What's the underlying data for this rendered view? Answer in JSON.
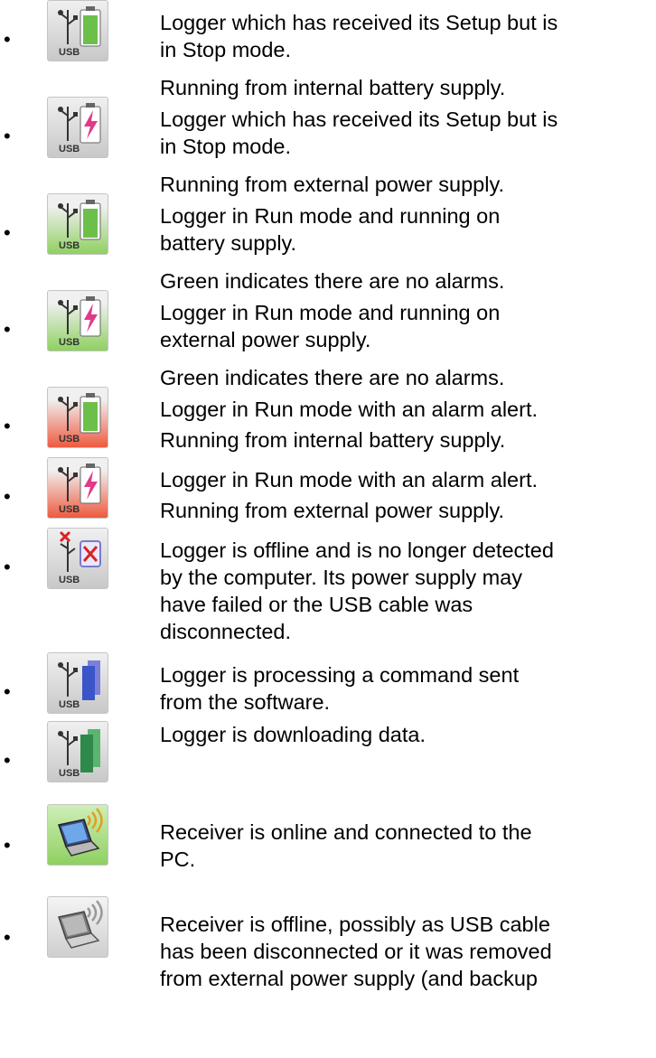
{
  "items": [
    {
      "icon": "usb-logger-battery-stop-icon",
      "bg": "#d8d8d8",
      "text": [
        "Logger which has received its Setup but is",
        "in Stop mode."
      ],
      "sub": "Running from internal battery supply."
    },
    {
      "icon": "usb-logger-external-power-stop-icon",
      "bg": "#d8d8d8",
      "text": [
        "Logger which has received its Setup but is",
        "in Stop mode."
      ],
      "sub": "Running from external power supply."
    },
    {
      "icon": "usb-logger-battery-run-icon",
      "bg": "#9fd86f",
      "text": [
        "Logger in Run mode and running on",
        "battery supply."
      ],
      "sub": "Green indicates there are no alarms."
    },
    {
      "icon": "usb-logger-external-power-run-icon",
      "bg": "#9fd86f",
      "text": [
        "Logger in Run mode and running on",
        "external power supply."
      ],
      "sub": "Green indicates there are no alarms."
    },
    {
      "icon": "usb-logger-battery-alarm-icon",
      "bg": "#ee5a3f",
      "text": [
        "Logger in Run mode with an alarm alert."
      ],
      "sub": "Running from internal battery supply."
    },
    {
      "icon": "usb-logger-external-power-alarm-icon",
      "bg": "#ee5a3f",
      "text": [
        "Logger in Run mode with an alarm alert."
      ],
      "sub": "Running from external power supply."
    },
    {
      "icon": "usb-logger-offline-icon",
      "bg": "#d8d8d8",
      "text": [
        "Logger is offline and is no longer detected",
        "by the computer. Its power supply may",
        "have failed or the USB cable was",
        "disconnected."
      ],
      "sub": ""
    },
    {
      "icon": "usb-logger-processing-icon",
      "bg": "#d8d8d8",
      "text": [
        "Logger is processing a command sent",
        "from the software."
      ],
      "sub": ""
    },
    {
      "icon": "usb-logger-downloading-icon",
      "bg": "#d8d8d8",
      "text": [
        "Logger is downloading data."
      ],
      "sub": ""
    },
    {
      "icon": "receiver-online-laptop-icon",
      "bg": "#8fd061",
      "text": [
        "Receiver is online and connected to the",
        "PC."
      ],
      "sub": ""
    },
    {
      "icon": "receiver-offline-laptop-icon",
      "bg": "#d8d8d8",
      "text": [
        "Receiver is offline, possibly as USB cable",
        "has been disconnected or it was removed",
        "from external power supply (and backup"
      ],
      "sub": ""
    }
  ]
}
